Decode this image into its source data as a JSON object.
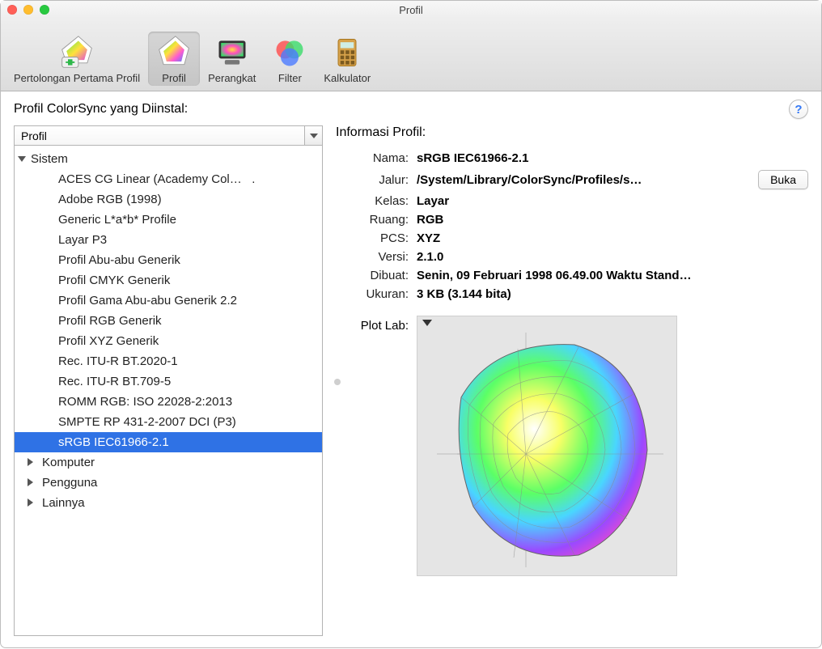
{
  "window": {
    "title": "Profil"
  },
  "toolbar": {
    "items": [
      {
        "label": "Pertolongan Pertama Profil",
        "icon": "profile-firstaid-icon",
        "active": false
      },
      {
        "label": "Profil",
        "icon": "profile-icon",
        "active": true
      },
      {
        "label": "Perangkat",
        "icon": "devices-icon",
        "active": false
      },
      {
        "label": "Filter",
        "icon": "filters-icon",
        "active": false
      },
      {
        "label": "Kalkulator",
        "icon": "calculator-icon",
        "active": false
      }
    ]
  },
  "left": {
    "heading": "Profil ColorSync yang Diinstal:",
    "combo_label": "Profil",
    "tree": {
      "sistem": {
        "label": "Sistem",
        "open": true,
        "items": [
          "ACES CG Linear (Academy Col…",
          "Adobe RGB (1998)",
          "Generic L*a*b* Profile",
          "Layar P3",
          "Profil Abu-abu Generik",
          "Profil CMYK Generik",
          "Profil Gama Abu-abu Generik 2.2",
          "Profil RGB Generik",
          "Profil XYZ Generik",
          "Rec. ITU-R BT.2020-1",
          "Rec. ITU-R BT.709-5",
          "ROMM RGB: ISO 22028-2:2013",
          "SMPTE RP 431-2-2007 DCI (P3)",
          "sRGB IEC61966-2.1"
        ],
        "selected": "sRGB IEC61966-2.1"
      },
      "komputer": {
        "label": "Komputer",
        "open": false
      },
      "pengguna": {
        "label": "Pengguna",
        "open": false
      },
      "lainnya": {
        "label": "Lainnya",
        "open": false
      }
    }
  },
  "right": {
    "heading": "Informasi Profil:",
    "open_button": "Buka",
    "rows": {
      "nama": {
        "k": "Nama:",
        "v": "sRGB IEC61966-2.1"
      },
      "jalur": {
        "k": "Jalur:",
        "v": "/System/Library/ColorSync/Profiles/s…"
      },
      "kelas": {
        "k": "Kelas:",
        "v": "Layar"
      },
      "ruang": {
        "k": "Ruang:",
        "v": "RGB"
      },
      "pcs": {
        "k": "PCS:",
        "v": "XYZ"
      },
      "versi": {
        "k": "Versi:",
        "v": "2.1.0"
      },
      "dibuat": {
        "k": "Dibuat:",
        "v": "Senin, 09 Februari 1998 06.49.00 Waktu Stand…"
      },
      "ukuran": {
        "k": "Ukuran:",
        "v": "3 KB (3.144 bita)"
      }
    },
    "plot_label": "Plot Lab:"
  },
  "help": "?"
}
